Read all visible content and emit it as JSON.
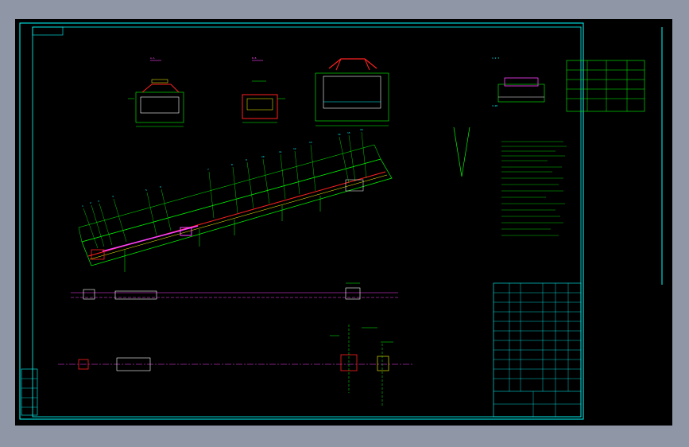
{
  "colors": {
    "background": "#8f97a6",
    "canvas": "#000000",
    "frame": "#00ffff",
    "geometry": "#00ff00",
    "accent_magenta": "#ff40ff",
    "accent_red": "#ff2020",
    "accent_yellow": "#ffff00",
    "accent_white": "#ffffff"
  },
  "section_labels": {
    "view_a": "A-A",
    "view_b": "B-B",
    "view_c": "C-C"
  },
  "leader_numbers": [
    "1",
    "2",
    "3",
    "4",
    "5",
    "6",
    "7",
    "8",
    "9",
    "10",
    "11",
    "12",
    "13",
    "14",
    "15",
    "16",
    "17",
    "18",
    "19",
    "20",
    "21",
    "22"
  ],
  "icons": {
    "main_view": "inclined-conveyor-drawing",
    "plan_view": "conveyor-plan-view",
    "title_block": "title-block-table"
  }
}
